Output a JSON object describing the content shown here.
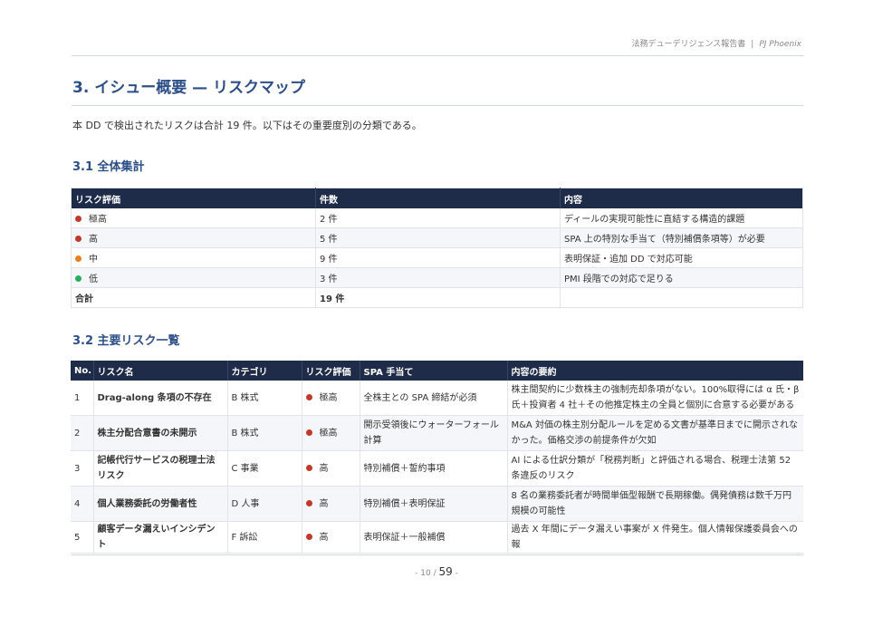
{
  "header": {
    "doc_title": "法務デューデリジェンス報告書",
    "separator": "|",
    "project": "PJ Phoenix"
  },
  "section": {
    "title": "3. イシュー概要 — リスクマップ",
    "intro": "本 DD で検出されたリスクは合計 19 件。以下はその重要度別の分類である。"
  },
  "summary": {
    "heading": "3.1 全体集計",
    "columns": [
      "リスク評価",
      "件数",
      "内容"
    ],
    "rows": [
      {
        "level": "極高",
        "color": "#c0392b",
        "count": "2 件",
        "content": "ディールの実現可能性に直結する構造的課題"
      },
      {
        "level": "高",
        "color": "#c0392b",
        "count": "5 件",
        "content": "SPA 上の特別な手当て（特別補償条項等）が必要"
      },
      {
        "level": "中",
        "color": "#e67e22",
        "count": "9 件",
        "content": "表明保証・追加 DD で対応可能"
      },
      {
        "level": "低",
        "color": "#27ae60",
        "count": "3 件",
        "content": "PMI 段階での対応で足りる"
      }
    ],
    "total": {
      "label": "合計",
      "count": "19 件",
      "content": ""
    }
  },
  "risks": {
    "heading": "3.2 主要リスク一覧",
    "columns": [
      "No.",
      "リスク名",
      "カテゴリ",
      "リスク評価",
      "SPA 手当て",
      "内容の要約"
    ],
    "rows": [
      {
        "no": "1",
        "name": "Drag-along 条項の不存在",
        "category": "B 株式",
        "level": "極高",
        "color": "#c0392b",
        "spa": "全株主との SPA 締結が必須",
        "summary": "株主間契約に少数株主の強制売却条項がない。100%取得には α 氏・β 氏＋投資者 4 社＋その他推定株主の全員と個別に合意する必要がある"
      },
      {
        "no": "2",
        "name": "株主分配合意書の未開示",
        "category": "B 株式",
        "level": "極高",
        "color": "#c0392b",
        "spa": "開示受領後にウォーターフォール計算",
        "summary": "M&A 対価の株主別分配ルールを定める文書が基準日までに開示されなかった。価格交渉の前提条件が欠如"
      },
      {
        "no": "3",
        "name": "記帳代行サービスの税理士法リスク",
        "category": "C 事業",
        "level": "高",
        "color": "#c0392b",
        "spa": "特別補償＋誓約事項",
        "summary": "AI による仕訳分類が「税務判断」と評価される場合、税理士法第 52 条違反のリスク"
      },
      {
        "no": "4",
        "name": "個人業務委託の労働者性",
        "category": "D 人事",
        "level": "高",
        "color": "#c0392b",
        "spa": "特別補償＋表明保証",
        "summary": "8 名の業務委託者が時間単価型報酬で長期稼働。偶発債務は数千万円規模の可能性"
      },
      {
        "no": "5",
        "name": "顧客データ漏えいインシデント",
        "category": "F 訴訟",
        "level": "高",
        "color": "#c0392b",
        "spa": "表明保証＋一般補償",
        "summary": "過去 X 年間にデータ漏えい事案が X 件発生。個人情報保護委員会への報"
      }
    ]
  },
  "footer": {
    "prefix": "- ",
    "page": "10",
    "slash": " / ",
    "total": "59",
    "suffix": " -"
  }
}
